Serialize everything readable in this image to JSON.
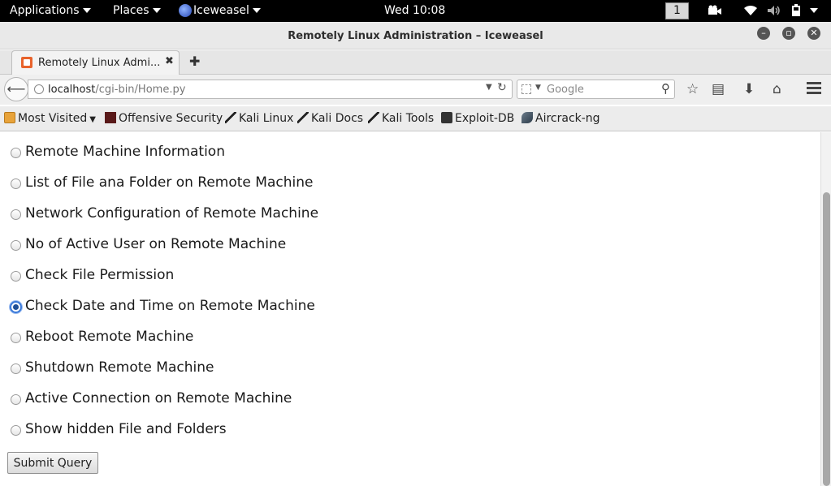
{
  "topbar": {
    "applications": "Applications",
    "places": "Places",
    "app_name": "Iceweasel",
    "clock": "Wed 10:08",
    "workspace": "1"
  },
  "window": {
    "title": "Remotely Linux Administration – Iceweasel"
  },
  "tab": {
    "title": "Remotely Linux Admi...",
    "close_glyph": "✖",
    "new_tab_glyph": "✚"
  },
  "nav": {
    "url_host": "localhost",
    "url_path": "/cgi-bin/Home.py",
    "search_placeholder": "Google"
  },
  "bookmarks": [
    {
      "label": "Most Visited",
      "icon": "folder-icon"
    },
    {
      "label": "Offensive Security",
      "icon": "offsec-icon"
    },
    {
      "label": "Kali Linux",
      "icon": "kali-dragon-icon"
    },
    {
      "label": "Kali Docs",
      "icon": "kali-dragon-icon"
    },
    {
      "label": "Kali Tools",
      "icon": "kali-dragon-icon"
    },
    {
      "label": "Exploit-DB",
      "icon": "exploit-db-icon"
    },
    {
      "label": "Aircrack-ng",
      "icon": "aircrack-icon"
    }
  ],
  "form": {
    "options": [
      {
        "label": "Remote Machine Information",
        "checked": false
      },
      {
        "label": "List of File ana Folder on Remote Machine",
        "checked": false
      },
      {
        "label": "Network Configuration of Remote Machine",
        "checked": false
      },
      {
        "label": "No of Active User on Remote Machine",
        "checked": false
      },
      {
        "label": "Check File Permission",
        "checked": false
      },
      {
        "label": "Check Date and Time on Remote Machine",
        "checked": true
      },
      {
        "label": "Reboot Remote Machine",
        "checked": false
      },
      {
        "label": "Shutdown Remote Machine",
        "checked": false
      },
      {
        "label": "Active Connection on Remote Machine",
        "checked": false
      },
      {
        "label": "Show hidden File and Folders",
        "checked": false
      }
    ],
    "submit_label": "Submit Query"
  },
  "colors": {
    "topbar_bg": "#000000",
    "radio_checked": "#1f4f96",
    "tab_favicon": "#e8632c"
  }
}
